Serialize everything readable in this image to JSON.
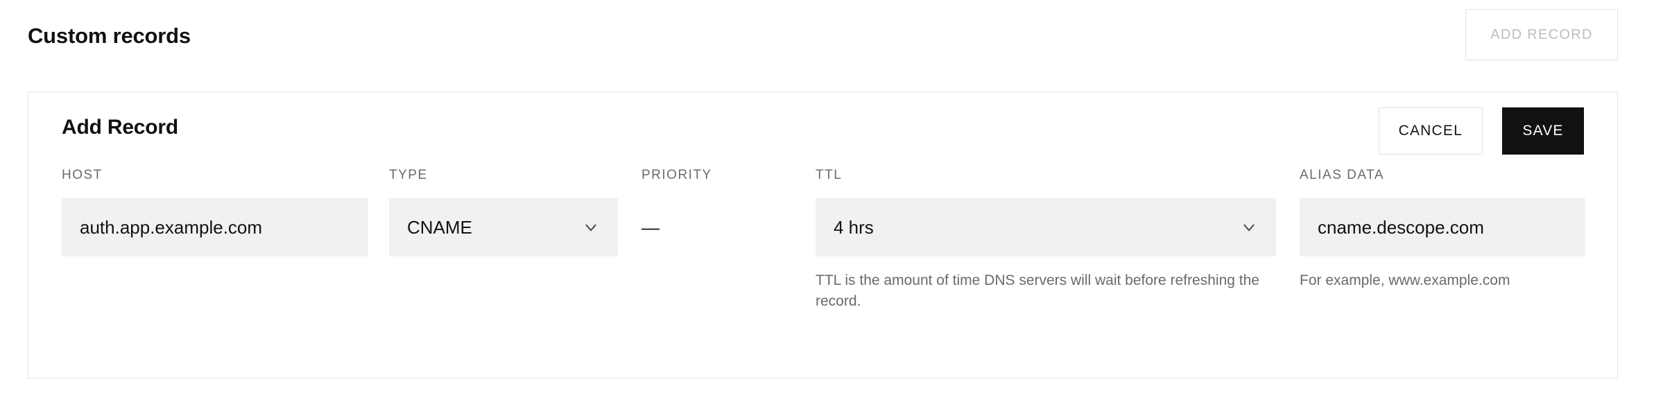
{
  "section": {
    "title": "Custom records",
    "add_record_label": "ADD RECORD"
  },
  "card": {
    "title": "Add Record",
    "cancel_label": "CANCEL",
    "save_label": "SAVE"
  },
  "form": {
    "host": {
      "label": "HOST",
      "value": "auth.app.example.com",
      "placeholder": "auth.app.example.com"
    },
    "type": {
      "label": "TYPE",
      "value": "CNAME",
      "icon": "chevron-down-icon"
    },
    "priority": {
      "label": "PRIORITY",
      "value": "—"
    },
    "ttl": {
      "label": "TTL",
      "value": "4 hrs",
      "icon": "chevron-down-icon",
      "helper": "TTL is the amount of time DNS servers will wait before refreshing the record."
    },
    "alias_data": {
      "label": "ALIAS DATA",
      "value": "cname.descope.com",
      "placeholder": "cname.descope.com",
      "helper": "For example, www.example.com"
    }
  },
  "colors": {
    "page_background": "#ffffff",
    "card_border": "#e4e4e4",
    "input_background": "#f1f1f1",
    "label_text": "#6b6b6b",
    "primary_button_background": "#111111",
    "primary_button_text": "#ffffff",
    "disabled_button_text": "#bdbdbd",
    "helper_text": "#6a6a6a"
  }
}
